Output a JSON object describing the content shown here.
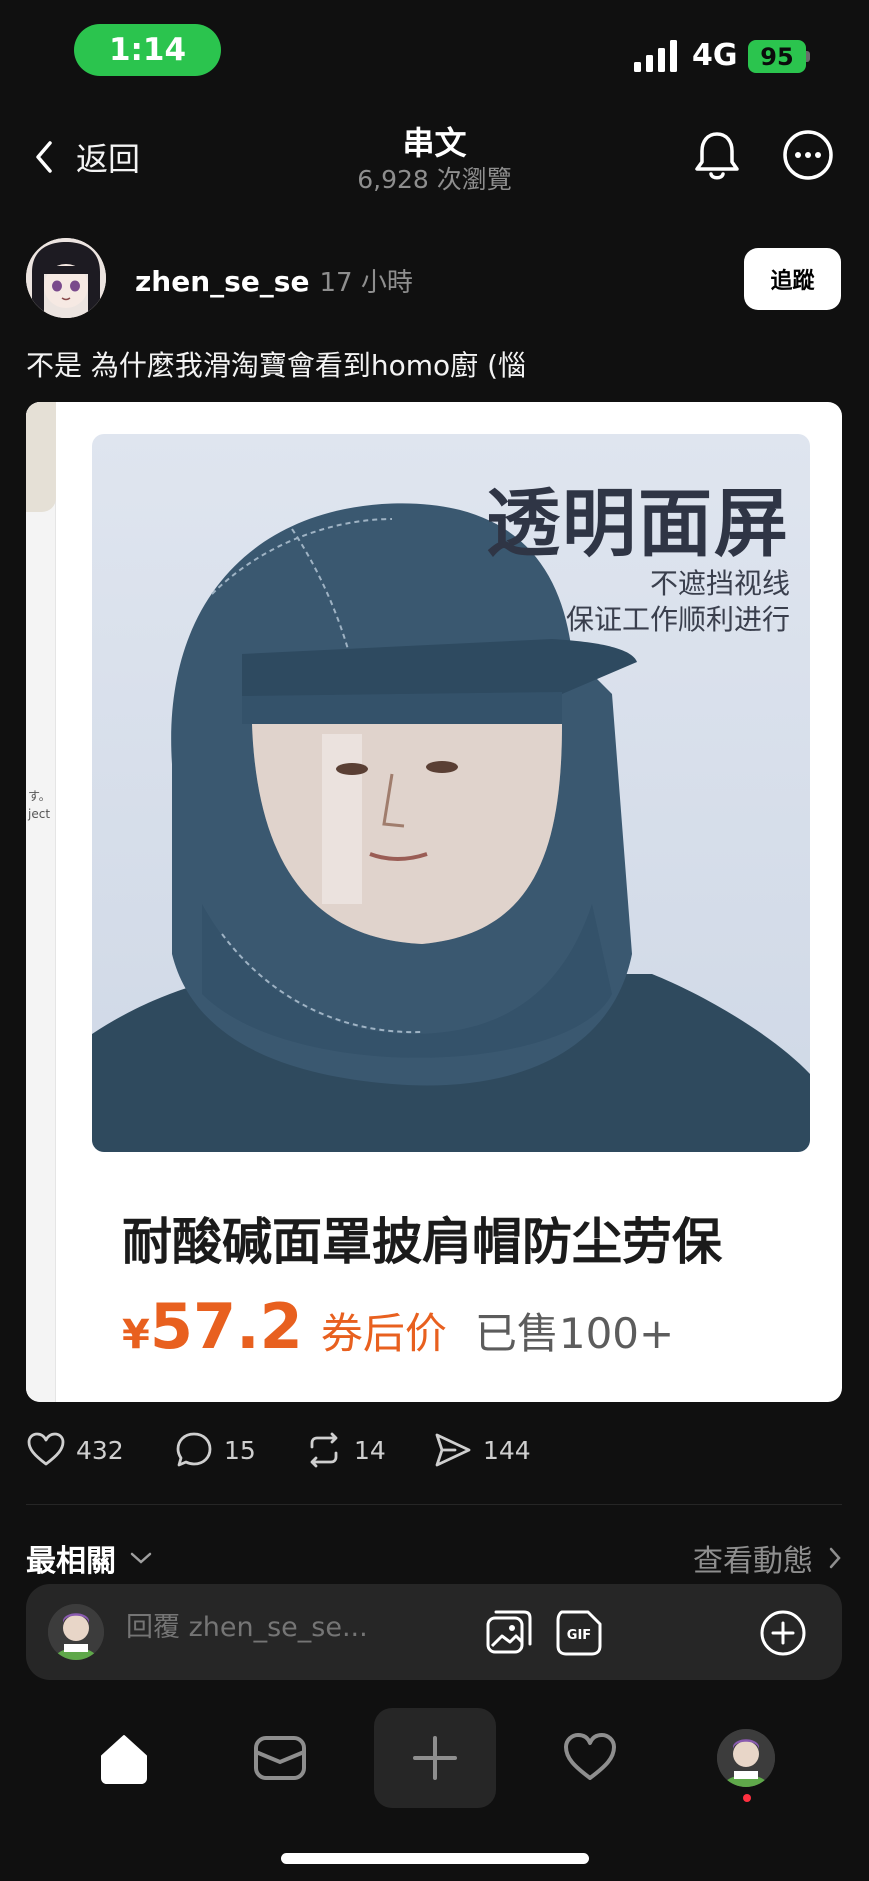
{
  "status_bar": {
    "time": "1:14",
    "network": "4G",
    "battery": "95",
    "accent": "#2bc44e"
  },
  "header": {
    "back_label": "返回",
    "title": "串文",
    "subtitle": "6,928 次瀏覽",
    "icons": [
      "bell-icon",
      "more-icon"
    ]
  },
  "post": {
    "username": "zhen_se_se",
    "time": "17 小時",
    "follow_label": "追蹤",
    "text": "不是 為什麼我滑淘寶會看到homo廚 (惱",
    "image": {
      "strip_text_1": "す。",
      "strip_text_2": "ject",
      "headline": "透明面屏",
      "tag1": "不遮挡视线",
      "tag2": "保证工作顺利进行",
      "product_name": "耐酸碱面罩披肩帽防尘劳保",
      "price_symbol": "¥",
      "price": "57.2",
      "price_note": "券后价",
      "sold": "已售100+"
    },
    "actions": {
      "likes": "432",
      "comments": "15",
      "reposts": "14",
      "shares": "144"
    }
  },
  "sort": {
    "label": "最相關",
    "activity_label": "查看動態"
  },
  "reply": {
    "placeholder": "回覆 zhen_se_se..."
  },
  "nav": {
    "items": [
      "home-icon",
      "inbox-icon",
      "add-icon",
      "heart-icon",
      "profile-avatar"
    ],
    "badge_color": "#ff3040"
  }
}
